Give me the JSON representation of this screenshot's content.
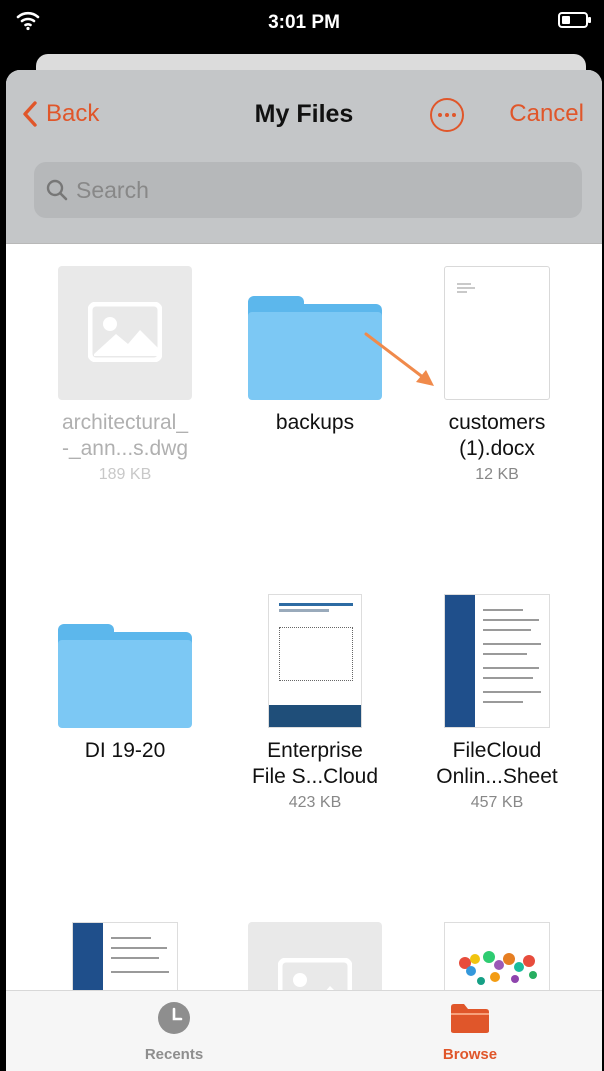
{
  "status_bar": {
    "time": "3:01 PM"
  },
  "nav": {
    "back_label": "Back",
    "title": "My Files",
    "cancel_label": "Cancel",
    "search_placeholder": "Search"
  },
  "files": [
    {
      "name_line1": "architectural_",
      "name_line2": "-_ann...s.dwg",
      "size": "189 KB",
      "kind": "placeholder",
      "dimmed": true
    },
    {
      "name_line1": "backups",
      "name_line2": "",
      "size": "",
      "kind": "folder",
      "dimmed": false
    },
    {
      "name_line1": "customers",
      "name_line2": "(1).docx",
      "size": "12 KB",
      "kind": "document",
      "dimmed": false
    },
    {
      "name_line1": "DI 19-20",
      "name_line2": "",
      "size": "",
      "kind": "folder",
      "dimmed": false
    },
    {
      "name_line1": "Enterprise",
      "name_line2": "File S...Cloud",
      "size": "423 KB",
      "kind": "pdf",
      "dimmed": false
    },
    {
      "name_line1": "FileCloud",
      "name_line2": "Onlin...Sheet",
      "size": "457 KB",
      "kind": "pdf",
      "dimmed": false
    },
    {
      "name_line1": "",
      "name_line2": "",
      "size": "",
      "kind": "pdf",
      "dimmed": false
    },
    {
      "name_line1": "",
      "name_line2": "",
      "size": "",
      "kind": "placeholder",
      "dimmed": false
    },
    {
      "name_line1": "",
      "name_line2": "",
      "size": "",
      "kind": "image",
      "dimmed": false
    }
  ],
  "tab_bar": {
    "recents_label": "Recents",
    "browse_label": "Browse",
    "active": "Browse"
  },
  "colors": {
    "accent": "#e0562a",
    "folder": "#7cc8f4",
    "annotation_arrow": "#f08a4b"
  }
}
